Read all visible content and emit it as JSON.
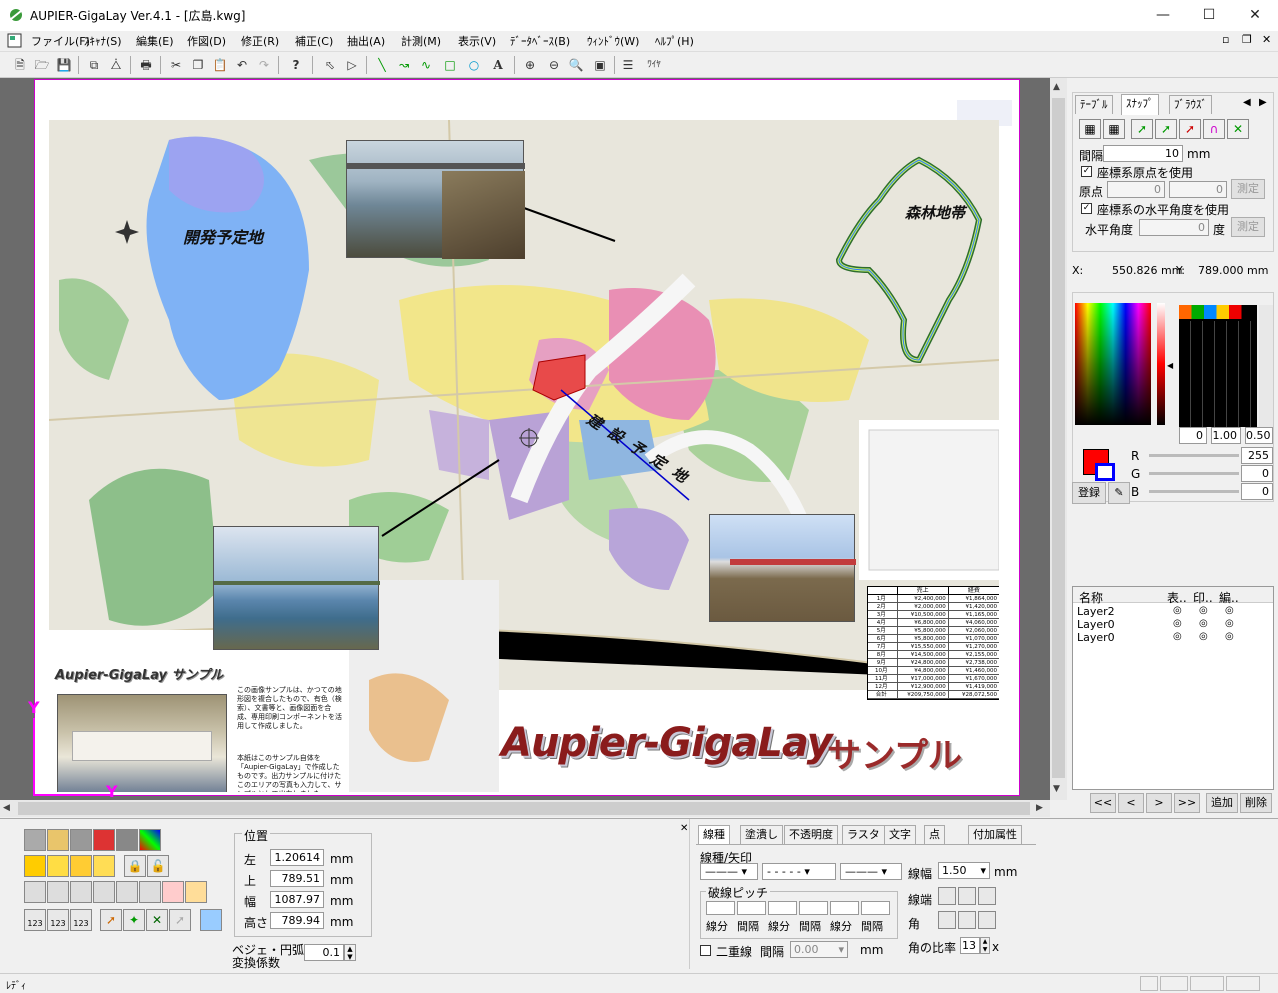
{
  "app": {
    "title": "AUPIER-GigaLay Ver.4.1 - [広島.kwg]"
  },
  "menu": [
    "ファイル(F)",
    "ｽｷｬﾅ(S)",
    "編集(E)",
    "作図(D)",
    "修正(R)",
    "補正(C)",
    "抽出(A)",
    "計測(M)",
    "表示(V)",
    "ﾃﾞｰﾀﾍﾞｰｽ(B)",
    "ｳｨﾝﾄﾞｳ(W)",
    "ﾍﾙﾌﾟ(H)"
  ],
  "map": {
    "label_dev": "開発予定地",
    "label_forest": "森林地帯",
    "label_build": "建設予定地",
    "label_sample_small": "Aupier-GigaLay サンプル",
    "label_sample_big": "Aupier-GigaLay",
    "label_sample_big2": "サンプル",
    "body_text1": "この画像サンプルは、かつての地形図を複合したもので、有色（検索）、文書等と、画像図面を合成、専用印刷コンポーネントを活用して作成しました。",
    "body_text2": "本紙はこのサンプル自体を「Aupier-GigaLay」で作成したものです。出力サンプルに付けたこのエリアの写真も入力して、サンプルとして出力しました。",
    "table_headers": [
      "",
      "売上",
      "経費"
    ],
    "table_rows": [
      [
        "1月",
        "¥2,400,000",
        "¥1,864,000"
      ],
      [
        "2月",
        "¥2,000,000",
        "¥1,420,000"
      ],
      [
        "3月",
        "¥10,500,000",
        "¥1,165,000"
      ],
      [
        "4月",
        "¥6,800,000",
        "¥4,060,000"
      ],
      [
        "5月",
        "¥5,800,000",
        "¥2,060,000"
      ],
      [
        "6月",
        "¥5,800,000",
        "¥1,070,000"
      ],
      [
        "7月",
        "¥15,550,000",
        "¥1,270,000"
      ],
      [
        "8月",
        "¥14,500,000",
        "¥2,155,000"
      ],
      [
        "9月",
        "¥24,800,000",
        "¥2,738,000"
      ],
      [
        "10月",
        "¥4,800,000",
        "¥1,460,000"
      ],
      [
        "11月",
        "¥17,000,000",
        "¥1,670,000"
      ],
      [
        "12月",
        "¥12,900,000",
        "¥1,419,000"
      ],
      [
        "合計",
        "¥209,750,000",
        "¥28,072,500"
      ]
    ]
  },
  "right": {
    "tabs": [
      "ﾃｰﾌﾞﾙ",
      "ｽﾅｯﾌﾟ",
      "ﾌﾞﾗｳｽﾞ"
    ],
    "spacing_label": "間隔",
    "spacing_value": "10",
    "spacing_unit": "mm",
    "use_origin": "座標系原点を使用",
    "origin_label": "原点",
    "origin_x": "0",
    "origin_y": "0",
    "measure": "測定",
    "use_angle": "座標系の水平角度を使用",
    "angle_label": "水平角度",
    "angle_value": "0",
    "angle_unit": "度",
    "x_label": "X:",
    "x_value": "550.826 mm",
    "y_label": "Y:",
    "y_value": "789.000 mm",
    "palette_vals": [
      "0",
      "1.00",
      "0.50"
    ],
    "r_label": "R",
    "r_value": "255",
    "g_label": "G",
    "g_value": "0",
    "b_label": "B",
    "b_value": "0",
    "register": "登録",
    "layer_headers": [
      "名称",
      "表..",
      "印..",
      "編.."
    ],
    "layers": [
      "Layer2",
      "Layer0",
      "Layer0"
    ],
    "nav": [
      "<<",
      "<",
      ">",
      ">>"
    ],
    "add": "追加",
    "delete": "削除"
  },
  "bottom": {
    "pos_title": "位置",
    "left_label": "左",
    "left_value": "1.20614",
    "top_label": "上",
    "top_value": "789.51",
    "width_label": "幅",
    "width_value": "1087.97",
    "height_label": "高さ",
    "height_value": "789.94",
    "unit": "mm",
    "bezier_label1": "ベジェ・円弧",
    "bezier_label2": "変換係数",
    "bezier_value": "0.1",
    "tabs": [
      "線種",
      "塗潰し",
      "不透明度",
      "ラスタ",
      "文字",
      "点",
      "付加属性"
    ],
    "linetype_label": "線種/矢印",
    "linewidth_label": "線幅",
    "linewidth_value": "1.50",
    "linewidth_unit": "mm",
    "dash_label": "破線ピッチ",
    "dash_cols": [
      "線分",
      "間隔",
      "線分",
      "間隔",
      "線分",
      "間隔"
    ],
    "double_label": "二重線",
    "gap_label": "間隔",
    "gap_value": "0.00",
    "gap_unit": "mm",
    "lineend_label": "線端",
    "corner_label": "角",
    "ratio_label": "角の比率",
    "ratio_value": "13",
    "ratio_unit": "x"
  },
  "status": {
    "text": "ﾚﾃﾞｨ"
  }
}
